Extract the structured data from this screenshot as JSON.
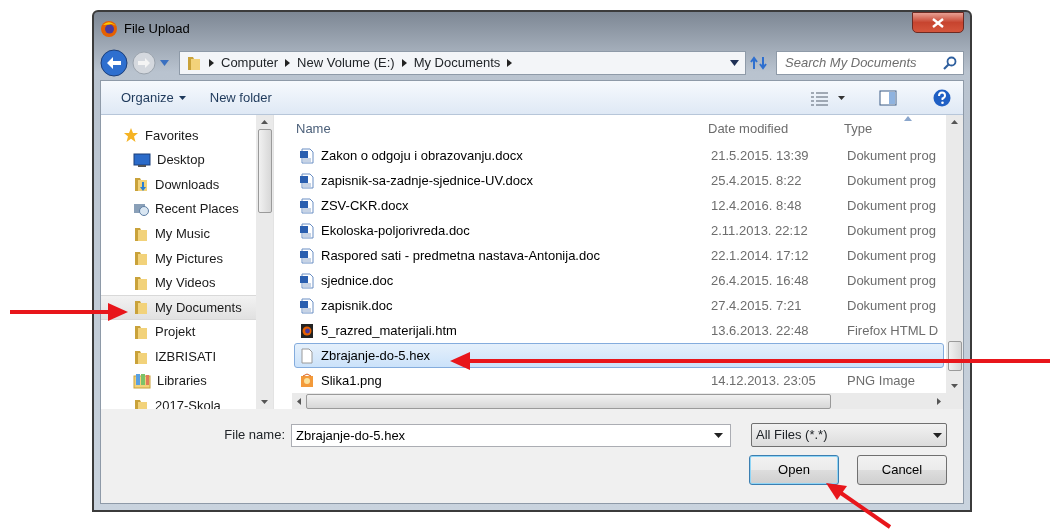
{
  "window": {
    "title": "File Upload"
  },
  "breadcrumb": [
    "Computer",
    "New Volume (E:)",
    "My Documents"
  ],
  "search": {
    "placeholder": "Search My Documents"
  },
  "toolbar": {
    "organize": "Organize",
    "new_folder": "New folder"
  },
  "sidebar": {
    "items": [
      {
        "label": "Favorites",
        "kind": "star",
        "selected": false
      },
      {
        "label": "Desktop",
        "kind": "desktop",
        "selected": false
      },
      {
        "label": "Downloads",
        "kind": "downloads",
        "selected": false
      },
      {
        "label": "Recent Places",
        "kind": "recent",
        "selected": false
      },
      {
        "label": "My Music",
        "kind": "folder",
        "selected": false
      },
      {
        "label": "My Pictures",
        "kind": "folder",
        "selected": false
      },
      {
        "label": "My Videos",
        "kind": "folder",
        "selected": false
      },
      {
        "label": "My Documents",
        "kind": "folder",
        "selected": true
      },
      {
        "label": "Projekt",
        "kind": "folder",
        "selected": false
      },
      {
        "label": "IZBRISATI",
        "kind": "folder",
        "selected": false
      },
      {
        "label": "Libraries",
        "kind": "library",
        "selected": false
      },
      {
        "label": "2017-Skola",
        "kind": "folder",
        "selected": false
      }
    ]
  },
  "table": {
    "columns": [
      "Name",
      "Date modified",
      "Type"
    ],
    "rows": [
      {
        "name": "Zakon o odgoju i obrazovanju.docx",
        "date": "21.5.2015. 13:39",
        "type": "Dokument prog",
        "kind": "word",
        "selected": false
      },
      {
        "name": "zapisnik-sa-zadnje-sjednice-UV.docx",
        "date": "25.4.2015. 8:22",
        "type": "Dokument prog",
        "kind": "word",
        "selected": false
      },
      {
        "name": "ZSV-CKR.docx",
        "date": "12.4.2016. 8:48",
        "type": "Dokument prog",
        "kind": "word",
        "selected": false
      },
      {
        "name": "Ekoloska-poljorivreda.doc",
        "date": "2.11.2013. 22:12",
        "type": "Dokument prog",
        "kind": "word",
        "selected": false
      },
      {
        "name": "Raspored sati - predmetna nastava-Antonija.doc",
        "date": "22.1.2014. 17:12",
        "type": "Dokument prog",
        "kind": "word",
        "selected": false
      },
      {
        "name": "sjednice.doc",
        "date": "26.4.2015. 16:48",
        "type": "Dokument prog",
        "kind": "word",
        "selected": false
      },
      {
        "name": "zapisnik.doc",
        "date": "27.4.2015. 7:21",
        "type": "Dokument prog",
        "kind": "word",
        "selected": false
      },
      {
        "name": "5_razred_materijali.htm",
        "date": "13.6.2013. 22:48",
        "type": "Firefox HTML D",
        "kind": "html",
        "selected": false
      },
      {
        "name": "Zbrajanje-do-5.hex",
        "kind": "blank",
        "selected": true
      },
      {
        "name": "Slika1.png",
        "date": "14.12.2013. 23:05",
        "type": "PNG Image",
        "kind": "image",
        "selected": false
      }
    ]
  },
  "file_name": {
    "label": "File name:",
    "value": "Zbrajanje-do-5.hex"
  },
  "file_type": {
    "value": "All Files (*.*)"
  },
  "buttons": [
    {
      "label": "Open",
      "default": true
    },
    {
      "label": "Cancel",
      "default": false
    }
  ]
}
